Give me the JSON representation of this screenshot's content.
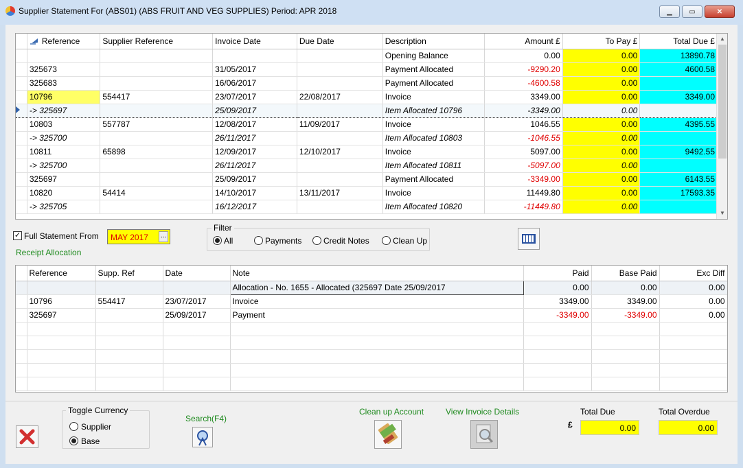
{
  "window": {
    "title": "Supplier Statement For (ABS01) (ABS  FRUIT AND VEG SUPPLIES) Period: APR 2018",
    "minimize_label": "▁",
    "restore_label": "▭",
    "close_label": "✕"
  },
  "statement": {
    "columns": [
      "Reference",
      "Supplier Reference",
      "Invoice Date",
      "Due Date",
      "Description",
      "Amount £",
      "To Pay £",
      "Total Due £"
    ],
    "rows": [
      {
        "ref": "",
        "supp_ref": "",
        "inv_date": "",
        "due_date": "",
        "desc": "Opening Balance",
        "amount": "0.00",
        "to_pay": "0.00",
        "total_due": "13890.78"
      },
      {
        "ref": "325673",
        "supp_ref": "",
        "inv_date": "31/05/2017",
        "due_date": "",
        "desc": "Payment Allocated",
        "amount": "-9290.20",
        "to_pay": "0.00",
        "total_due": "4600.58"
      },
      {
        "ref": "325683",
        "supp_ref": "",
        "inv_date": "16/06/2017",
        "due_date": "",
        "desc": "Payment Allocated",
        "amount": "-4600.58",
        "to_pay": "0.00",
        "total_due": ""
      },
      {
        "ref": "10796",
        "supp_ref": "554417",
        "inv_date": "23/07/2017",
        "due_date": "22/08/2017",
        "desc": "Invoice",
        "amount": "3349.00",
        "to_pay": "0.00",
        "total_due": "3349.00"
      },
      {
        "ref": "-> 325697",
        "supp_ref": "",
        "inv_date": "25/09/2017",
        "due_date": "",
        "desc": "Item Allocated 10796",
        "amount": "-3349.00",
        "to_pay": "0.00",
        "total_due": ""
      },
      {
        "ref": "10803",
        "supp_ref": "557787",
        "inv_date": "12/08/2017",
        "due_date": "11/09/2017",
        "desc": "Invoice",
        "amount": "1046.55",
        "to_pay": "0.00",
        "total_due": "4395.55"
      },
      {
        "ref": "-> 325700",
        "supp_ref": "",
        "inv_date": "26/11/2017",
        "due_date": "",
        "desc": "Item Allocated 10803",
        "amount": "-1046.55",
        "to_pay": "0.00",
        "total_due": ""
      },
      {
        "ref": "10811",
        "supp_ref": "65898",
        "inv_date": "12/09/2017",
        "due_date": "12/10/2017",
        "desc": "Invoice",
        "amount": "5097.00",
        "to_pay": "0.00",
        "total_due": "9492.55"
      },
      {
        "ref": "-> 325700",
        "supp_ref": "",
        "inv_date": "26/11/2017",
        "due_date": "",
        "desc": "Item Allocated 10811",
        "amount": "-5097.00",
        "to_pay": "0.00",
        "total_due": ""
      },
      {
        "ref": "325697",
        "supp_ref": "",
        "inv_date": "25/09/2017",
        "due_date": "",
        "desc": "Payment Allocated",
        "amount": "-3349.00",
        "to_pay": "0.00",
        "total_due": "6143.55"
      },
      {
        "ref": "10820",
        "supp_ref": "54414",
        "inv_date": "14/10/2017",
        "due_date": "13/11/2017",
        "desc": "Invoice",
        "amount": "11449.80",
        "to_pay": "0.00",
        "total_due": "17593.35"
      },
      {
        "ref": "-> 325705",
        "supp_ref": "",
        "inv_date": "16/12/2017",
        "due_date": "",
        "desc": "Item Allocated 10820",
        "amount": "-11449.80",
        "to_pay": "0.00",
        "total_due": ""
      }
    ]
  },
  "options": {
    "full_statement_label": "Full Statement From",
    "full_statement_date": "MAY 2017",
    "date_button_label": "...",
    "receipt_allocation_label": "Receipt Allocation"
  },
  "filter": {
    "title": "Filter",
    "options": [
      "All",
      "Payments",
      "Credit Notes",
      "Clean Up"
    ],
    "selected": "All"
  },
  "allocation": {
    "columns": [
      "Reference",
      "Supp. Ref",
      "Date",
      "Note",
      "Paid",
      "Base Paid",
      "Exc Diff"
    ],
    "header_row": {
      "note": "Allocation - No. 1655 - Allocated (325697 Date 25/09/2017",
      "paid": "0.00",
      "base_paid": "0.00",
      "exc_diff": "0.00"
    },
    "rows": [
      {
        "ref": "10796",
        "supp_ref": "554417",
        "date": "23/07/2017",
        "note": "Invoice",
        "paid": "3349.00",
        "base_paid": "3349.00",
        "exc_diff": "0.00"
      },
      {
        "ref": "325697",
        "supp_ref": "",
        "date": "25/09/2017",
        "note": "Payment",
        "paid": "-3349.00",
        "base_paid": "-3349.00",
        "exc_diff": "0.00"
      }
    ]
  },
  "toggle_currency": {
    "title": "Toggle Currency",
    "options": [
      "Supplier",
      "Base"
    ],
    "selected": "Base"
  },
  "actions": {
    "search_label": "Search(F4)",
    "clean_up_label": "Clean up Account",
    "view_invoice_label": "View Invoice Details"
  },
  "totals": {
    "currency_symbol": "£",
    "total_due_label": "Total Due",
    "total_due_value": "0.00",
    "total_overdue_label": "Total Overdue",
    "total_overdue_value": "0.00"
  },
  "colors": {
    "highlight_yellow": "#ffff00",
    "highlight_cyan": "#00ffff",
    "negative_red": "#e00000",
    "link_green": "#1e8a1e"
  }
}
